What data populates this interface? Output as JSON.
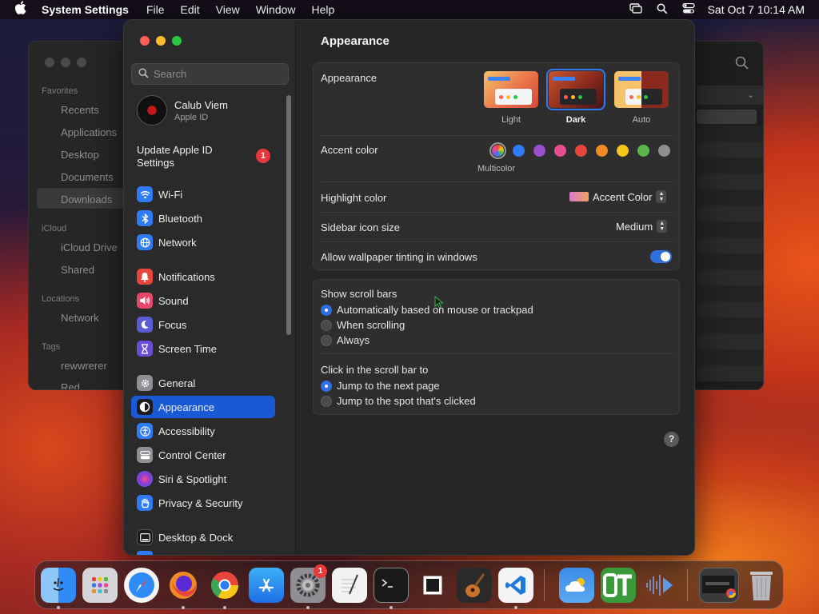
{
  "menubar": {
    "app_name": "System Settings",
    "menus": [
      "File",
      "Edit",
      "View",
      "Window",
      "Help"
    ],
    "clock": "Sat Oct 7  10:14 AM"
  },
  "finder": {
    "sections": {
      "favorites": "Favorites",
      "icloud": "iCloud",
      "locations": "Locations",
      "tags": "Tags"
    },
    "items": {
      "recents": "Recents",
      "applications": "Applications",
      "desktop": "Desktop",
      "documents": "Documents",
      "downloads": "Downloads",
      "icloud_drive": "iCloud Drive",
      "shared": "Shared",
      "network": "Network",
      "tag1": "rewwrerer",
      "tag2": "Red"
    }
  },
  "sidebar": {
    "search_placeholder": "Search",
    "profile_name": "Calub Viem",
    "profile_sub": "Apple ID",
    "update_label": "Update Apple ID Settings",
    "update_badge": "1",
    "items": [
      {
        "label": "Wi-Fi",
        "icon": "wifi-icon",
        "color": "#2f7bf6"
      },
      {
        "label": "Bluetooth",
        "icon": "bluetooth-icon",
        "color": "#2f7bf6"
      },
      {
        "label": "Network",
        "icon": "globe-icon",
        "color": "#2f7bf6"
      },
      {
        "label": "Notifications",
        "icon": "bell-icon",
        "color": "#e8453c"
      },
      {
        "label": "Sound",
        "icon": "speaker-icon",
        "color": "#e8456a"
      },
      {
        "label": "Focus",
        "icon": "moon-icon",
        "color": "#5b5bd6"
      },
      {
        "label": "Screen Time",
        "icon": "hourglass-icon",
        "color": "#6a4fd6"
      },
      {
        "label": "General",
        "icon": "gear-icon",
        "color": "#8e8e93"
      },
      {
        "label": "Appearance",
        "icon": "appearance-icon",
        "color": "#1c1c1e"
      },
      {
        "label": "Accessibility",
        "icon": "accessibility-icon",
        "color": "#2f7bf6"
      },
      {
        "label": "Control Center",
        "icon": "control-center-icon",
        "color": "#8e8e93"
      },
      {
        "label": "Siri & Spotlight",
        "icon": "siri-icon",
        "color": "#8a3bd6"
      },
      {
        "label": "Privacy & Security",
        "icon": "hand-icon",
        "color": "#2f7bf6"
      },
      {
        "label": "Desktop & Dock",
        "icon": "dock-icon",
        "color": "#1c1c1e"
      }
    ]
  },
  "content": {
    "title": "Appearance",
    "appearance_label": "Appearance",
    "modes": [
      {
        "label": "Light",
        "selected": false
      },
      {
        "label": "Dark",
        "selected": true
      },
      {
        "label": "Auto",
        "selected": false
      }
    ],
    "accent_label": "Accent color",
    "accent_colors": [
      "multicolor",
      "#2f7bf6",
      "#9b4fcf",
      "#e84d8f",
      "#e8453c",
      "#f08a24",
      "#f5c518",
      "#5ab84b",
      "#8e8e93"
    ],
    "accent_caption": "Multicolor",
    "highlight_label": "Highlight color",
    "highlight_value": "Accent Color",
    "sidebar_icon_label": "Sidebar icon size",
    "sidebar_icon_value": "Medium",
    "wallpaper_tint_label": "Allow wallpaper tinting in windows",
    "wallpaper_tint_on": true,
    "scroll_bars_label": "Show scroll bars",
    "scroll_options": [
      {
        "label": "Automatically based on mouse or trackpad",
        "selected": true
      },
      {
        "label": "When scrolling",
        "selected": false
      },
      {
        "label": "Always",
        "selected": false
      }
    ],
    "click_label": "Click in the scroll bar to",
    "click_options": [
      {
        "label": "Jump to the next page",
        "selected": true
      },
      {
        "label": "Jump to the spot that's clicked",
        "selected": false
      }
    ],
    "help": "?"
  },
  "dock": {
    "apps": [
      {
        "name": "finder-icon",
        "color": "#2f8bf6"
      },
      {
        "name": "launchpad-icon",
        "color": "#9aa0aa"
      },
      {
        "name": "safari-icon",
        "color": "#2f8bf6"
      },
      {
        "name": "firefox-icon",
        "color": "#e8532a"
      },
      {
        "name": "chrome-icon",
        "color": "#e8e8e8"
      },
      {
        "name": "app-store-icon",
        "color": "#1e88f0"
      },
      {
        "name": "system-settings-icon",
        "color": "#8e8e93"
      },
      {
        "name": "textedit-icon",
        "color": "#f2f2f2"
      },
      {
        "name": "terminal-icon",
        "color": "#1a1a1a"
      },
      {
        "name": "window-icon",
        "color": "#f2f2f2"
      },
      {
        "name": "garageband-icon",
        "color": "#2a2a2a"
      },
      {
        "name": "vscode-icon",
        "color": "#1e7ad6"
      },
      {
        "name": "weather-icon",
        "color": "#3c8ce6"
      },
      {
        "name": "ot-icon",
        "color": "#3a9a3a"
      },
      {
        "name": "audio-icon",
        "color": "#3a4a7a"
      },
      {
        "name": "screenshot-icon",
        "color": "#3a3a3a"
      },
      {
        "name": "trash-icon",
        "color": "#8e8e93"
      }
    ],
    "settings_badge": "1"
  }
}
